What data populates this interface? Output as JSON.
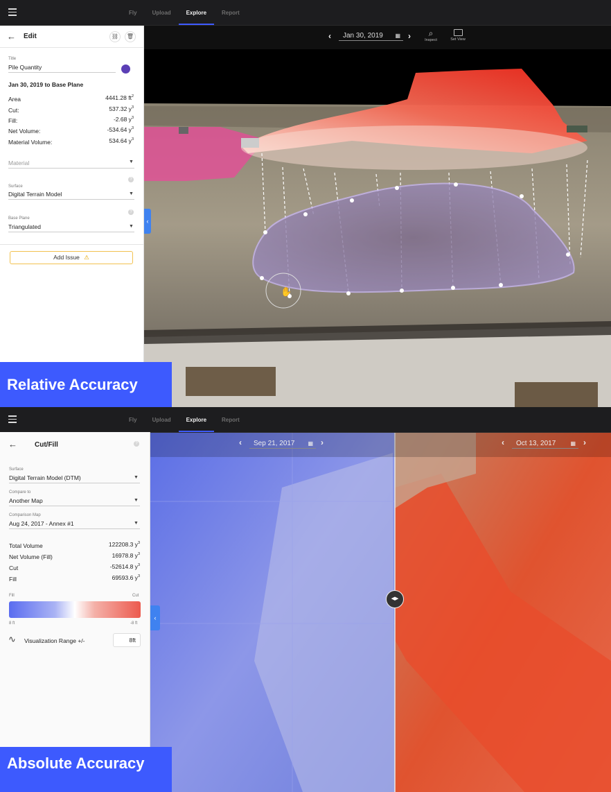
{
  "nav": {
    "menu_icon": "hamburger-icon",
    "tabs": [
      "Fly",
      "Upload",
      "Explore",
      "Report"
    ],
    "active": "Explore"
  },
  "top": {
    "header": {
      "title": "Edit",
      "back_icon": "arrow-left-icon",
      "link_icon": "link-icon",
      "delete_icon": "trash-icon"
    },
    "title_label": "Title",
    "title_value": "Pile Quantity",
    "color_dot": "#5b3fb5",
    "comparison": "Jan 30, 2019 to Base Plane",
    "stats": [
      {
        "label": "Area",
        "value": "4441.28 ft",
        "unit_sup": "2"
      },
      {
        "label": "Cut:",
        "value": "537.32 y",
        "unit_sup": "3"
      },
      {
        "label": "Fill:",
        "value": "-2.68 y",
        "unit_sup": "3"
      },
      {
        "label": "Net Volume:",
        "value": "-534.64 y",
        "unit_sup": "3"
      },
      {
        "label": "Material Volume:",
        "value": "534.64 y",
        "unit_sup": "3"
      }
    ],
    "material_placeholder": "Material",
    "surface_label": "Surface",
    "surface_value": "Digital Terrain Model",
    "base_plane_label": "Base Plane",
    "base_plane_value": "Triangulated",
    "add_issue": "Add Issue",
    "date": "Jan 30, 2019",
    "tools": [
      {
        "label": "Inspect",
        "icon": "inspect-icon"
      },
      {
        "label": "Set View",
        "icon": "set-view-icon"
      }
    ],
    "badge": "Relative Accuracy"
  },
  "bottom": {
    "header": {
      "title": "Cut/Fill",
      "back_icon": "arrow-left-icon"
    },
    "surface_label": "Surface",
    "surface_value": "Digital Terrain Model (DTM)",
    "compare_label": "Compare to",
    "compare_value": "Another Map",
    "comparison_map_label": "Comparison Map",
    "comparison_map_value": "Aug 24, 2017 - Annex #1",
    "stats": [
      {
        "label": "Total Volume",
        "value": "122208.3 y",
        "unit_sup": "3"
      },
      {
        "label": "Net Volume (Fill)",
        "value": "16978.8 y",
        "unit_sup": "3"
      },
      {
        "label": "Cut",
        "value": "-52614.8 y",
        "unit_sup": "3"
      },
      {
        "label": "Fill",
        "value": "69593.6 y",
        "unit_sup": "3"
      }
    ],
    "legend": {
      "fill_label": "Fill",
      "cut_label": "Cut",
      "min_label": "8 ft",
      "max_label": "-8 ft",
      "fill_color": "#5a6cf0",
      "cut_color": "#ec5a4e"
    },
    "viz_range_label": "Visualization Range +/-",
    "viz_range_value": "8ft",
    "date_left": "Sep 21, 2017",
    "date_right": "Oct 13, 2017",
    "badge": "Absolute Accuracy"
  }
}
